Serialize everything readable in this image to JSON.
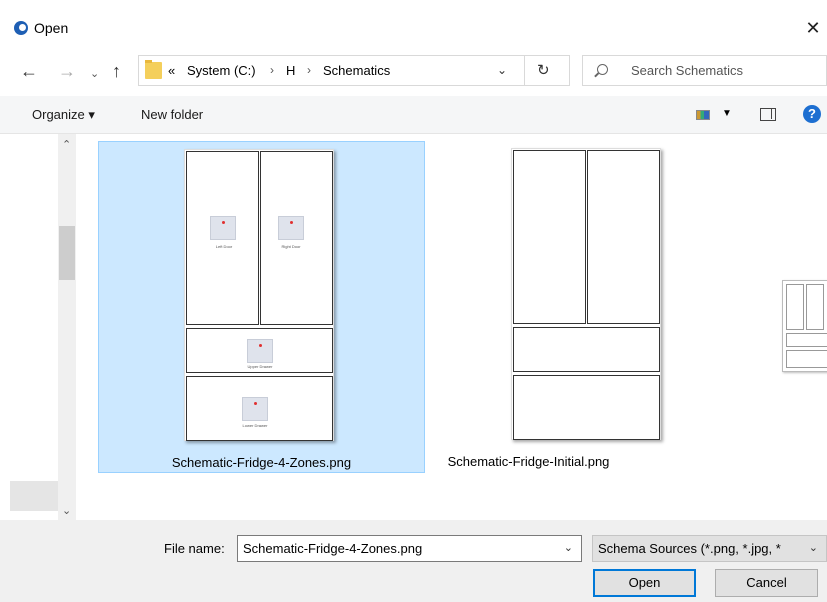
{
  "window": {
    "title": "Open",
    "close_glyph": "✕"
  },
  "nav": {
    "back": "←",
    "forward": "→",
    "recent": "⌄",
    "up": "↑",
    "breadcrumb": [
      {
        "label": "«"
      },
      {
        "label": "System (C:)"
      },
      {
        "label": "H"
      },
      {
        "label": "Schematics"
      }
    ],
    "separator": "›",
    "refresh": "↻",
    "dropdown": "⌄"
  },
  "search": {
    "placeholder": "Search Schematics"
  },
  "toolbar": {
    "organize_label": "Organize ▾",
    "new_folder_label": "New folder",
    "help_label": "?"
  },
  "scrollbar": {
    "up": "⌃",
    "down": "⌄"
  },
  "files": [
    {
      "name": "Schematic-Fridge-4-Zones.png",
      "selected": true,
      "zones": [
        "Left Door",
        "Right Door",
        "Upper Drawer",
        "Lower Drawer"
      ]
    },
    {
      "name": "Schematic-Fridge-Initial.png",
      "selected": false,
      "zones": []
    }
  ],
  "footer": {
    "file_name_label": "File name:",
    "file_name_value": "Schematic-Fridge-4-Zones.png",
    "filter_value": "Schema Sources (*.png, *.jpg, *",
    "open_label": "Open",
    "cancel_label": "Cancel",
    "dropdown": "⌄"
  },
  "colors": {
    "selection_bg": "#cce8ff",
    "selection_border": "#99d1ff",
    "accent": "#0078d7",
    "help": "#1d6fd1"
  }
}
